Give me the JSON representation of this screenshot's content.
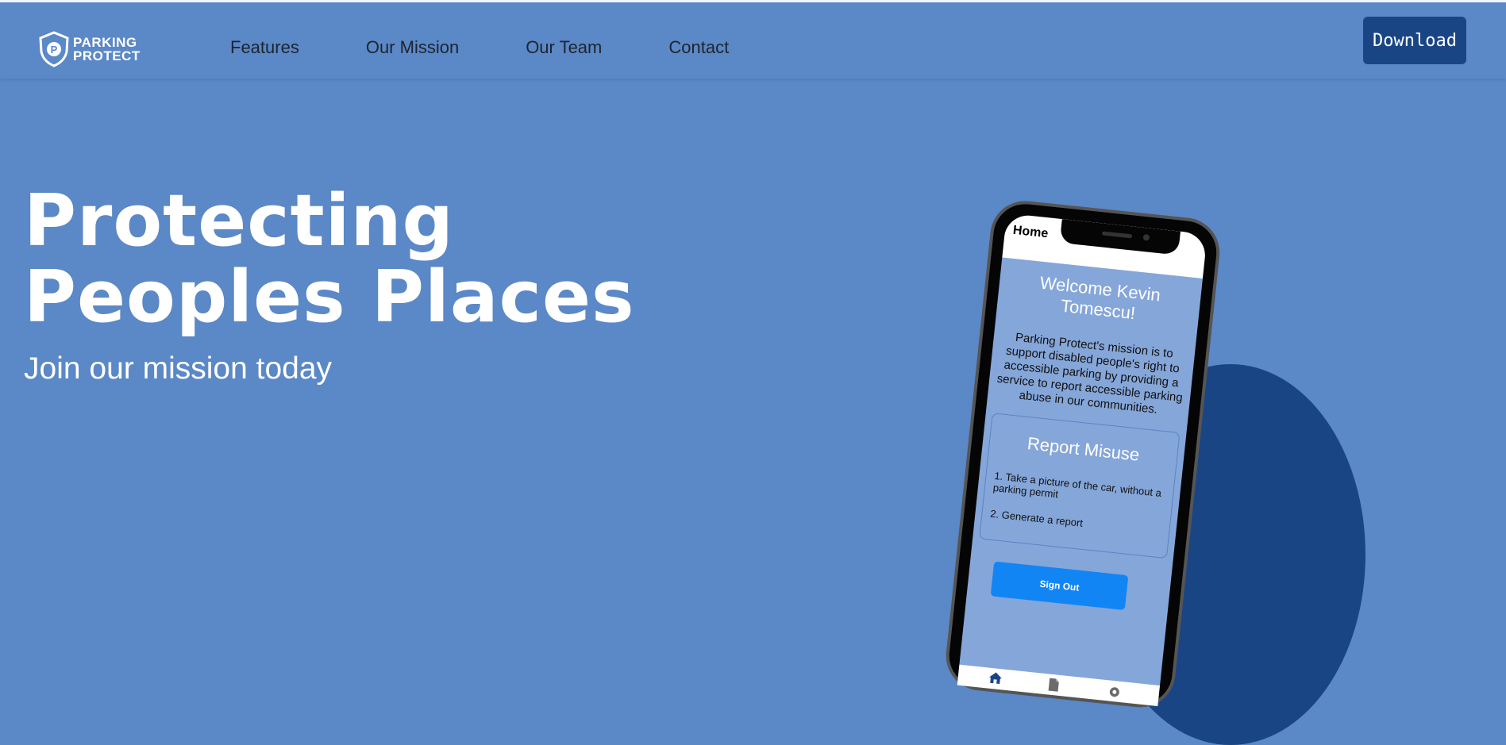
{
  "brand": {
    "name_line1": "PARKING",
    "name_line2": "PROTECT"
  },
  "nav": {
    "items": [
      {
        "label": "Features"
      },
      {
        "label": "Our Mission"
      },
      {
        "label": "Our Team"
      },
      {
        "label": "Contact"
      }
    ],
    "download_label": "Download"
  },
  "hero": {
    "title_line1": "Protecting",
    "title_line2": "Peoples Places",
    "subtitle": "Join our mission today"
  },
  "phone": {
    "header_label": "Home",
    "welcome_line1": "Welcome Kevin",
    "welcome_line2": "Tomescu!",
    "mission": "Parking Protect's mission is to support disabled people's right to accessible parking by providing a service to report accessible parking abuse in our communities.",
    "report_title": "Report Misuse",
    "step1": "1. Take a picture of the car, without a parking permit",
    "step2": "2. Generate a report",
    "signout_label": "Sign Out",
    "tab_home_label": "Home"
  },
  "icons": {
    "logo": "shield-p-icon",
    "tab_home": "home-icon",
    "tab_reports": "document-icon",
    "tab_settings": "gear-icon"
  },
  "colors": {
    "background": "#5b88c6",
    "accent_dark": "#1a4585",
    "button_blue": "#1285f5"
  }
}
